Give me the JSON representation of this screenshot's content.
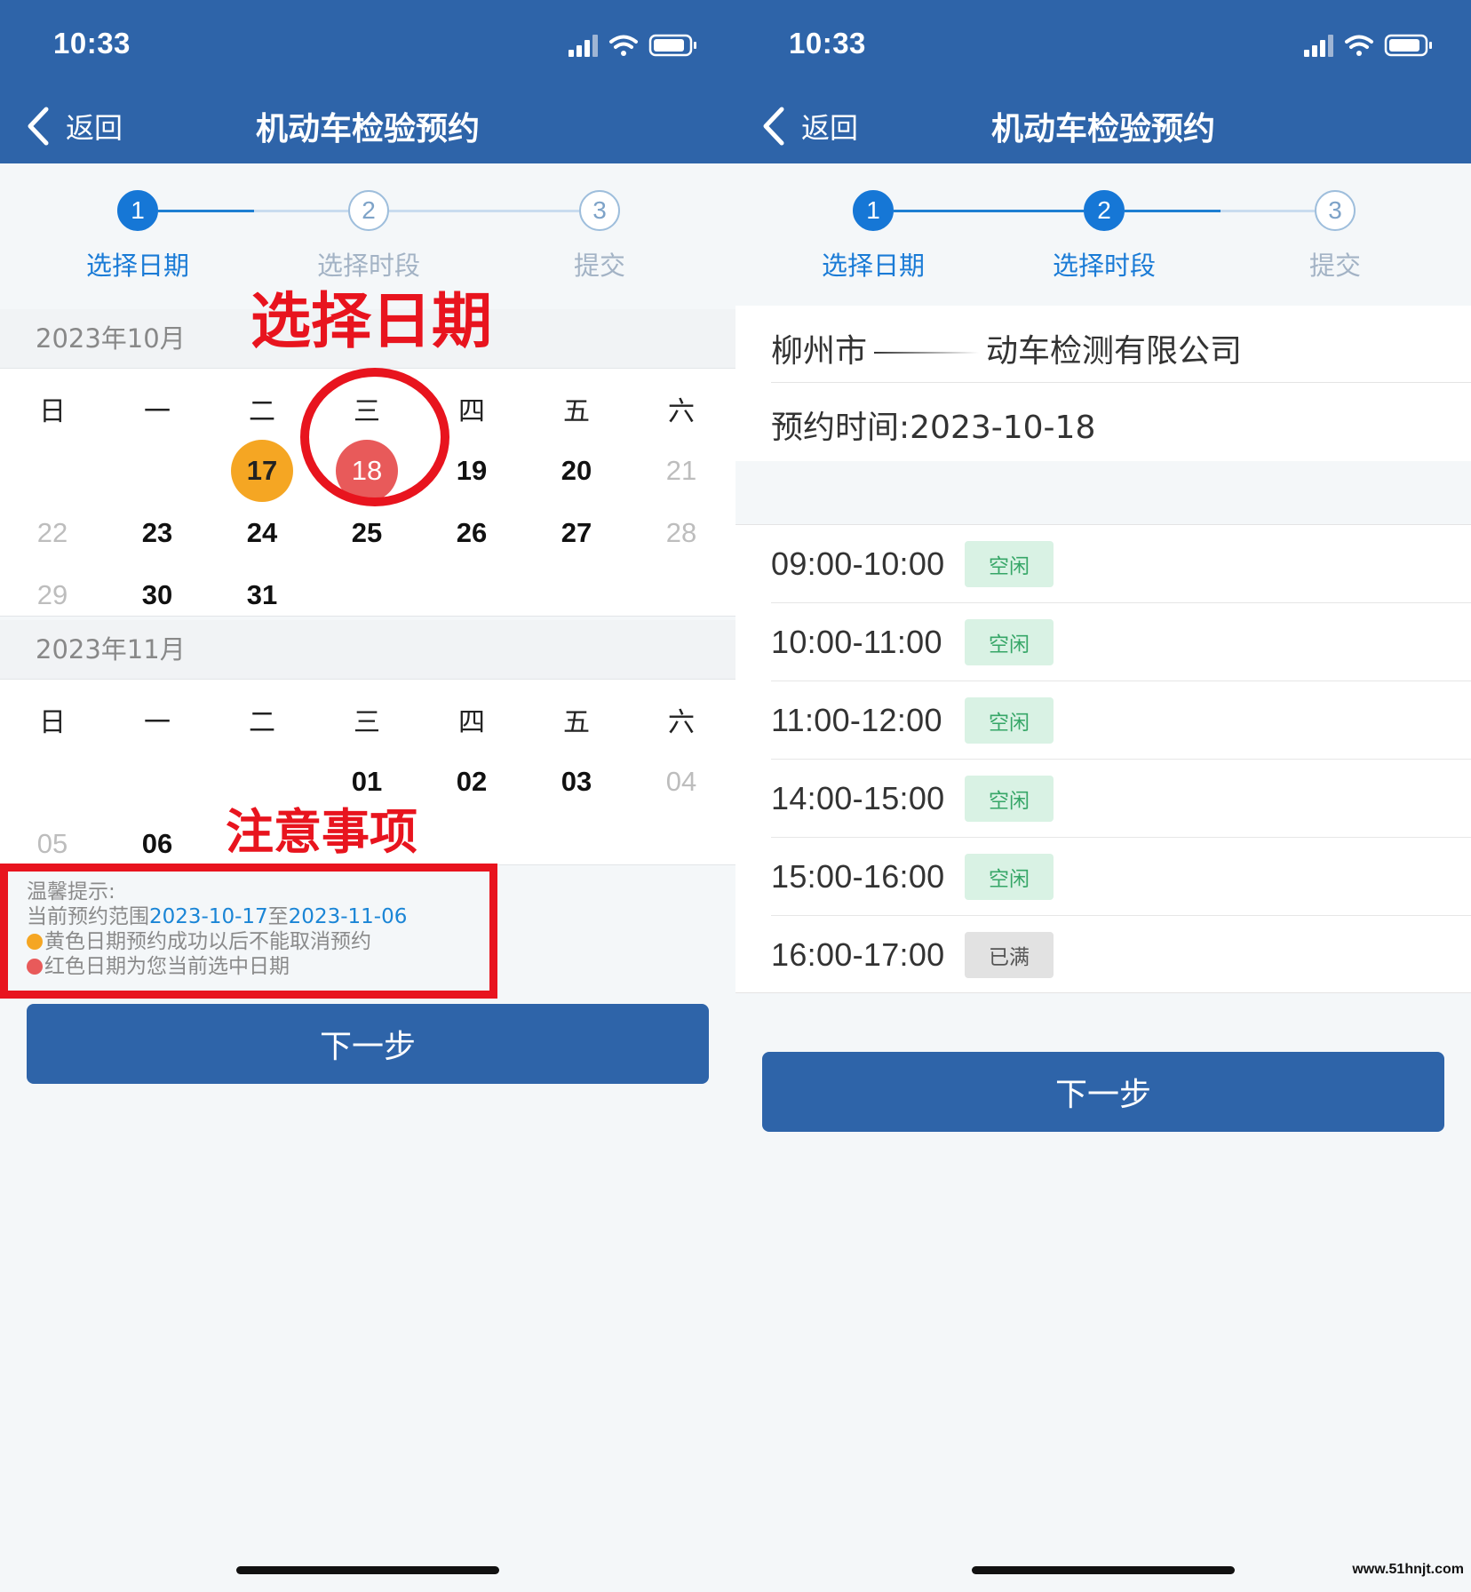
{
  "status_bar": {
    "time": "10:33"
  },
  "nav": {
    "back_label": "返回",
    "title": "机动车检验预约"
  },
  "steps": [
    {
      "number": "1",
      "label": "选择日期"
    },
    {
      "number": "2",
      "label": "选择时段"
    },
    {
      "number": "3",
      "label": "提交"
    }
  ],
  "weekdays": [
    "日",
    "一",
    "二",
    "三",
    "四",
    "五",
    "六"
  ],
  "calendar": {
    "october": {
      "title": "2023年10月",
      "days": [
        "17",
        "18",
        "19",
        "20",
        "21",
        "22",
        "23",
        "24",
        "25",
        "26",
        "27",
        "28",
        "29",
        "30",
        "31"
      ]
    },
    "november": {
      "title": "2023年11月",
      "days": [
        "01",
        "02",
        "03",
        "04",
        "05",
        "06"
      ]
    }
  },
  "annotations": {
    "select_date": "选择日期",
    "notes": "注意事项"
  },
  "tips": {
    "heading": "温馨提示:",
    "range_prefix": "当前预约范围",
    "range_start": "2023-10-17",
    "range_mid": "至",
    "range_end": "2023-11-06",
    "yellow_note": "黄色日期预约成功以后不能取消预约",
    "red_note": "红色日期为您当前选中日期"
  },
  "next_button": "下一步",
  "booking": {
    "company_prefix": "柳州市",
    "company_suffix": "动车检测有限公司",
    "time_label": "预约时间:",
    "time_value": "2023-10-18"
  },
  "slots": [
    {
      "time": "09:00-10:00",
      "status": "空闲"
    },
    {
      "time": "10:00-11:00",
      "status": "空闲"
    },
    {
      "time": "11:00-12:00",
      "status": "空闲"
    },
    {
      "time": "14:00-15:00",
      "status": "空闲"
    },
    {
      "time": "15:00-16:00",
      "status": "空闲"
    },
    {
      "time": "16:00-17:00",
      "status": "已满"
    }
  ],
  "watermark": "www.51hnjt.com",
  "colors": {
    "header_blue": "#2e64a9",
    "step_active": "#1677d6",
    "yellow_date": "#f5a623",
    "red_date": "#e85a5a",
    "annotation_red": "#e8141e",
    "free_badge": "#d9f2e4",
    "full_badge": "#e2e2e2"
  }
}
